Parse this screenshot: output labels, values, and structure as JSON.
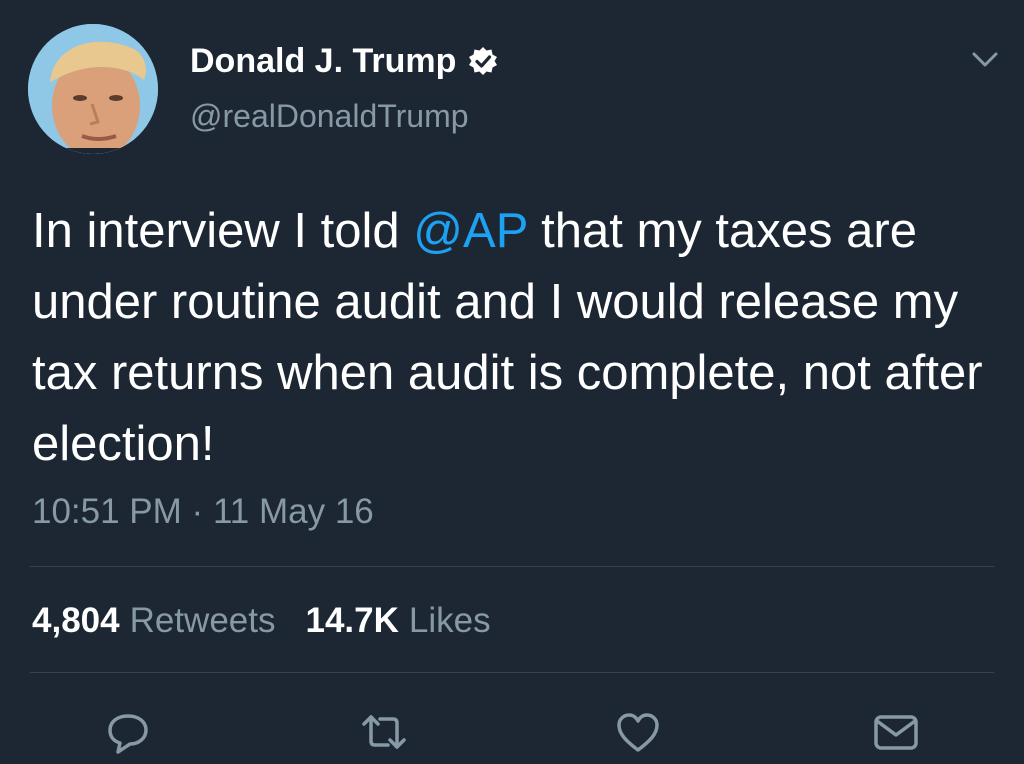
{
  "author": {
    "display_name": "Donald J. Trump",
    "handle": "@realDonaldTrump",
    "verified": true
  },
  "tweet": {
    "text_before": "In interview I told ",
    "mention": "@AP",
    "text_after": " that my taxes are under routine audit and I would release my tax returns when audit is complete, not after election!",
    "time": "10:51 PM",
    "separator": "·",
    "date": "11 May 16"
  },
  "stats": {
    "retweets_count": "4,804",
    "retweets_label": "Retweets",
    "likes_count": "14.7K",
    "likes_label": "Likes"
  },
  "icons": {
    "verified": "verified-badge-icon",
    "more": "chevron-down-icon",
    "reply": "reply-icon",
    "retweet": "retweet-icon",
    "like": "heart-icon",
    "share": "envelope-icon"
  },
  "colors": {
    "background": "#1c2733",
    "text": "#ffffff",
    "secondary_text": "#8899a6",
    "mention": "#1da1f2",
    "divider": "#38444d"
  }
}
